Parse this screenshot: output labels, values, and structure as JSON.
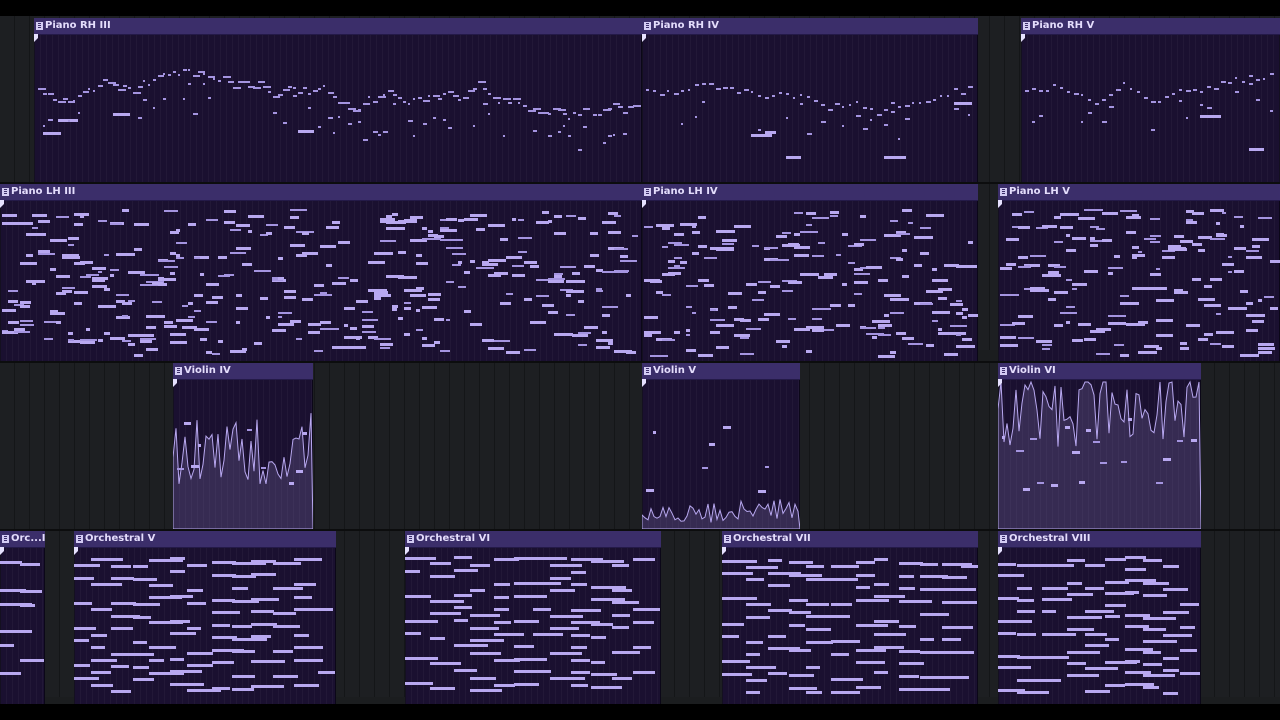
{
  "app": {
    "theme_accent": "#b8a8f0",
    "clip_header_color": "#3b2e6a",
    "clip_body_color": "#1a1030"
  },
  "tracks": [
    {
      "name": "piano-rh",
      "clips": [
        {
          "id": "piano-rh-iii",
          "title": "Piano RH III",
          "density": 0.55,
          "style": "melodic"
        },
        {
          "id": "piano-rh-iv",
          "title": "Piano RH IV",
          "density": 0.45,
          "style": "sparse"
        },
        {
          "id": "piano-rh-v",
          "title": "Piano RH V",
          "density": 0.45,
          "style": "sparse"
        }
      ]
    },
    {
      "name": "piano-lh",
      "clips": [
        {
          "id": "piano-lh-iii",
          "title": "Piano LH III",
          "density": 0.6,
          "style": "dense"
        },
        {
          "id": "piano-lh-iv",
          "title": "Piano LH IV",
          "density": 0.6,
          "style": "dense"
        },
        {
          "id": "piano-lh-v",
          "title": "Piano LH V",
          "density": 0.5,
          "style": "dense"
        }
      ]
    },
    {
      "name": "violin",
      "clips": [
        {
          "id": "violin-iv",
          "title": "Violin IV",
          "density": 0.5,
          "style": "automation"
        },
        {
          "id": "violin-v",
          "title": "Violin V",
          "density": 0.4,
          "style": "automation-low"
        },
        {
          "id": "violin-vi",
          "title": "Violin VI",
          "density": 0.6,
          "style": "automation-high"
        }
      ]
    },
    {
      "name": "orchestral",
      "clips": [
        {
          "id": "orchestral-iv",
          "title": "Orc...IV",
          "density": 0.5,
          "style": "chords"
        },
        {
          "id": "orchestral-v",
          "title": "Orchestral V",
          "density": 0.5,
          "style": "chords"
        },
        {
          "id": "orchestral-vi",
          "title": "Orchestral VI",
          "density": 0.5,
          "style": "chords"
        },
        {
          "id": "orchestral-vii",
          "title": "Orchestral VII",
          "density": 0.5,
          "style": "chords"
        },
        {
          "id": "orchestral-viii",
          "title": "Orchestral VIII",
          "density": 0.5,
          "style": "chords"
        }
      ]
    }
  ]
}
